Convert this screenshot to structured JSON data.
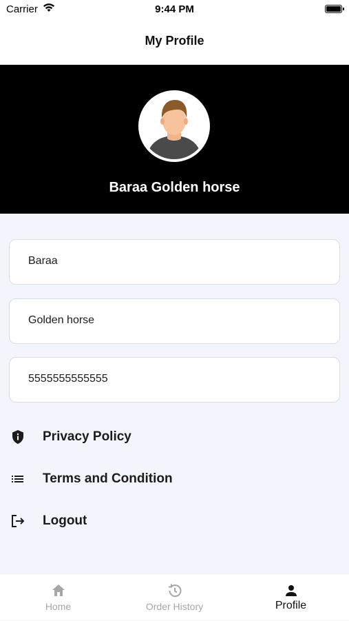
{
  "status": {
    "carrier": "Carrier",
    "time": "9:44 PM"
  },
  "header": {
    "title": "My Profile"
  },
  "profile": {
    "display_name": "Baraa Golden horse",
    "first_name": "Baraa",
    "last_name": "Golden horse",
    "phone": "5555555555555"
  },
  "menu": [
    {
      "label": "Privacy Policy",
      "icon": "shield-info-icon"
    },
    {
      "label": "Terms and Condition",
      "icon": "list-icon"
    },
    {
      "label": "Logout",
      "icon": "logout-icon"
    }
  ],
  "tabs": [
    {
      "label": "Home",
      "icon": "home-icon",
      "active": false
    },
    {
      "label": "Order History",
      "icon": "history-icon",
      "active": false
    },
    {
      "label": "Profile",
      "icon": "person-icon",
      "active": true
    }
  ],
  "colors": {
    "header_bg": "#000000",
    "page_bg": "#f2f5fb",
    "inactive_tab": "#a6a6a6"
  }
}
